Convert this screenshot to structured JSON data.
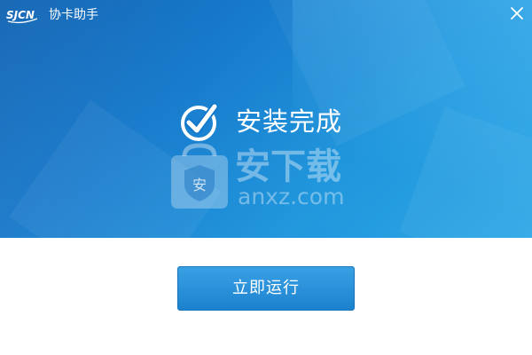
{
  "titlebar": {
    "logo_text": "SJCN",
    "title": "协卡助手",
    "close_icon": "close-icon"
  },
  "status": {
    "icon": "check-circle-icon",
    "text": "安装完成"
  },
  "watermark": {
    "icon": "shield-bag-icon",
    "badge": "安",
    "main": "安下载",
    "sub": "anxz.com"
  },
  "actions": {
    "launch_label": "立即运行"
  },
  "colors": {
    "hero_top_left": "#0a5fb0",
    "hero_bottom_right": "#2ea8e6",
    "button": "#1c82cf"
  }
}
